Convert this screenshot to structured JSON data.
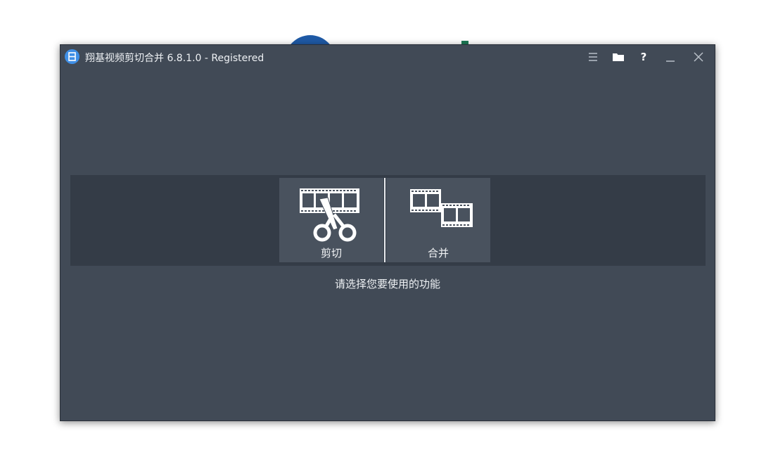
{
  "window": {
    "title": "翔基视频剪切合并 6.8.1.0 - Registered"
  },
  "titlebar": {
    "buttons": [
      {
        "icon": "menu-icon"
      },
      {
        "icon": "folder-icon"
      },
      {
        "icon": "help-icon"
      },
      {
        "icon": "minimize-icon"
      },
      {
        "icon": "close-icon"
      }
    ]
  },
  "functions": {
    "cut": {
      "label": "剪切",
      "icon": "film-scissors-icon"
    },
    "merge": {
      "label": "合并",
      "icon": "film-merge-icon"
    }
  },
  "prompt": "请选择您要使用的功能",
  "colors": {
    "window_bg": "#414a56",
    "band_bg": "#343c47",
    "button_bg": "#49525e",
    "logo_blue": "#3f8fe6",
    "text": "#eef1f4"
  }
}
